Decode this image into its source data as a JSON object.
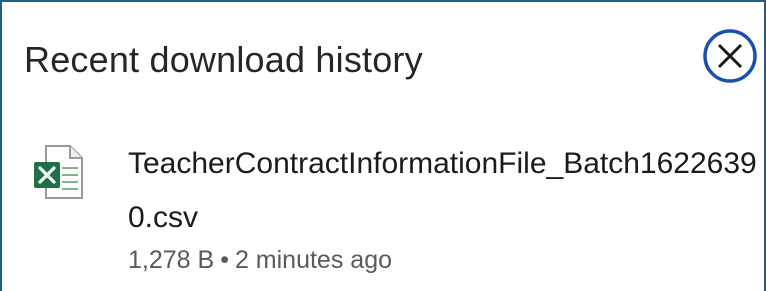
{
  "panel": {
    "title": "Recent download history",
    "close_icon": "close-circle-icon",
    "accent_color": "#1a4fb0"
  },
  "downloads": [
    {
      "file_name": "TeacherContractInformationFile_Batch16226390.csv",
      "size": "1,278 B",
      "separator": "•",
      "time": "2 minutes ago",
      "icon": "excel-file-icon",
      "icon_color": "#1e7145"
    }
  ]
}
